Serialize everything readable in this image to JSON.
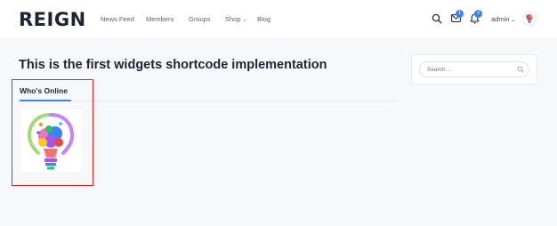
{
  "header": {
    "logo_text": "REIGN",
    "nav": [
      {
        "label": "News Feed",
        "has_dropdown": false
      },
      {
        "label": "Members",
        "has_dropdown": false
      },
      {
        "label": "Groups",
        "has_dropdown": false
      },
      {
        "label": "Shop",
        "has_dropdown": true
      },
      {
        "label": "Blog",
        "has_dropdown": false
      }
    ],
    "messages_count": "1",
    "notifications_count": "2",
    "user_name": "admin",
    "dropdown_glyph": "⌄",
    "icons": [
      "search-icon",
      "envelope-icon",
      "bell-icon",
      "chevron-down-icon",
      "avatar"
    ]
  },
  "main": {
    "title": "This is the first widgets shortcode implementation",
    "widget": {
      "title": "Who's Online",
      "members": [
        {
          "avatar": "colorful-lightbulb-avatar"
        }
      ]
    }
  },
  "sidebar": {
    "search_placeholder": "Search ...",
    "search_value": ""
  },
  "colors": {
    "accent": "#3b82f6",
    "highlight_border": "#e02424",
    "text_dark": "#1f2433",
    "nav_text": "#5b6170",
    "background": "#f7f8fa"
  }
}
